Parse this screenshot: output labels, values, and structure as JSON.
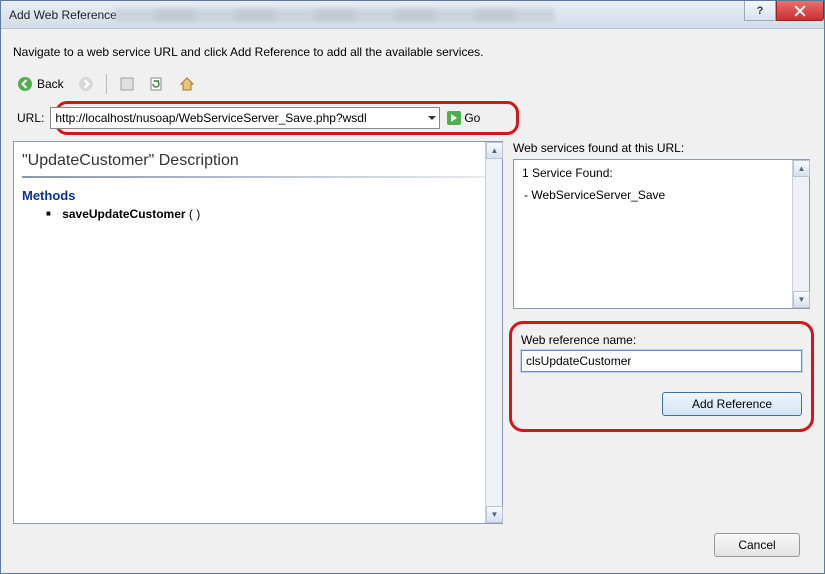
{
  "title": "Add Web Reference",
  "instruction": "Navigate to a web service URL and click Add Reference to add all the available services.",
  "toolbar": {
    "back_label": "Back"
  },
  "url": {
    "label": "URL:",
    "value": "http://localhost/nusoap/WebServiceServer_Save.php?wsdl",
    "go_label": "Go"
  },
  "description": {
    "title": "\"UpdateCustomer\" Description",
    "methods_heading": "Methods",
    "methods": [
      {
        "name": "saveUpdateCustomer",
        "signature": "( )"
      }
    ]
  },
  "services": {
    "found_label": "Web services found at this URL:",
    "summary": "1 Service Found:",
    "items": [
      "- WebServiceServer_Save"
    ]
  },
  "reference": {
    "label": "Web reference name:",
    "value": "clsUpdateCustomer",
    "add_button": "Add Reference"
  },
  "footer": {
    "cancel": "Cancel"
  }
}
